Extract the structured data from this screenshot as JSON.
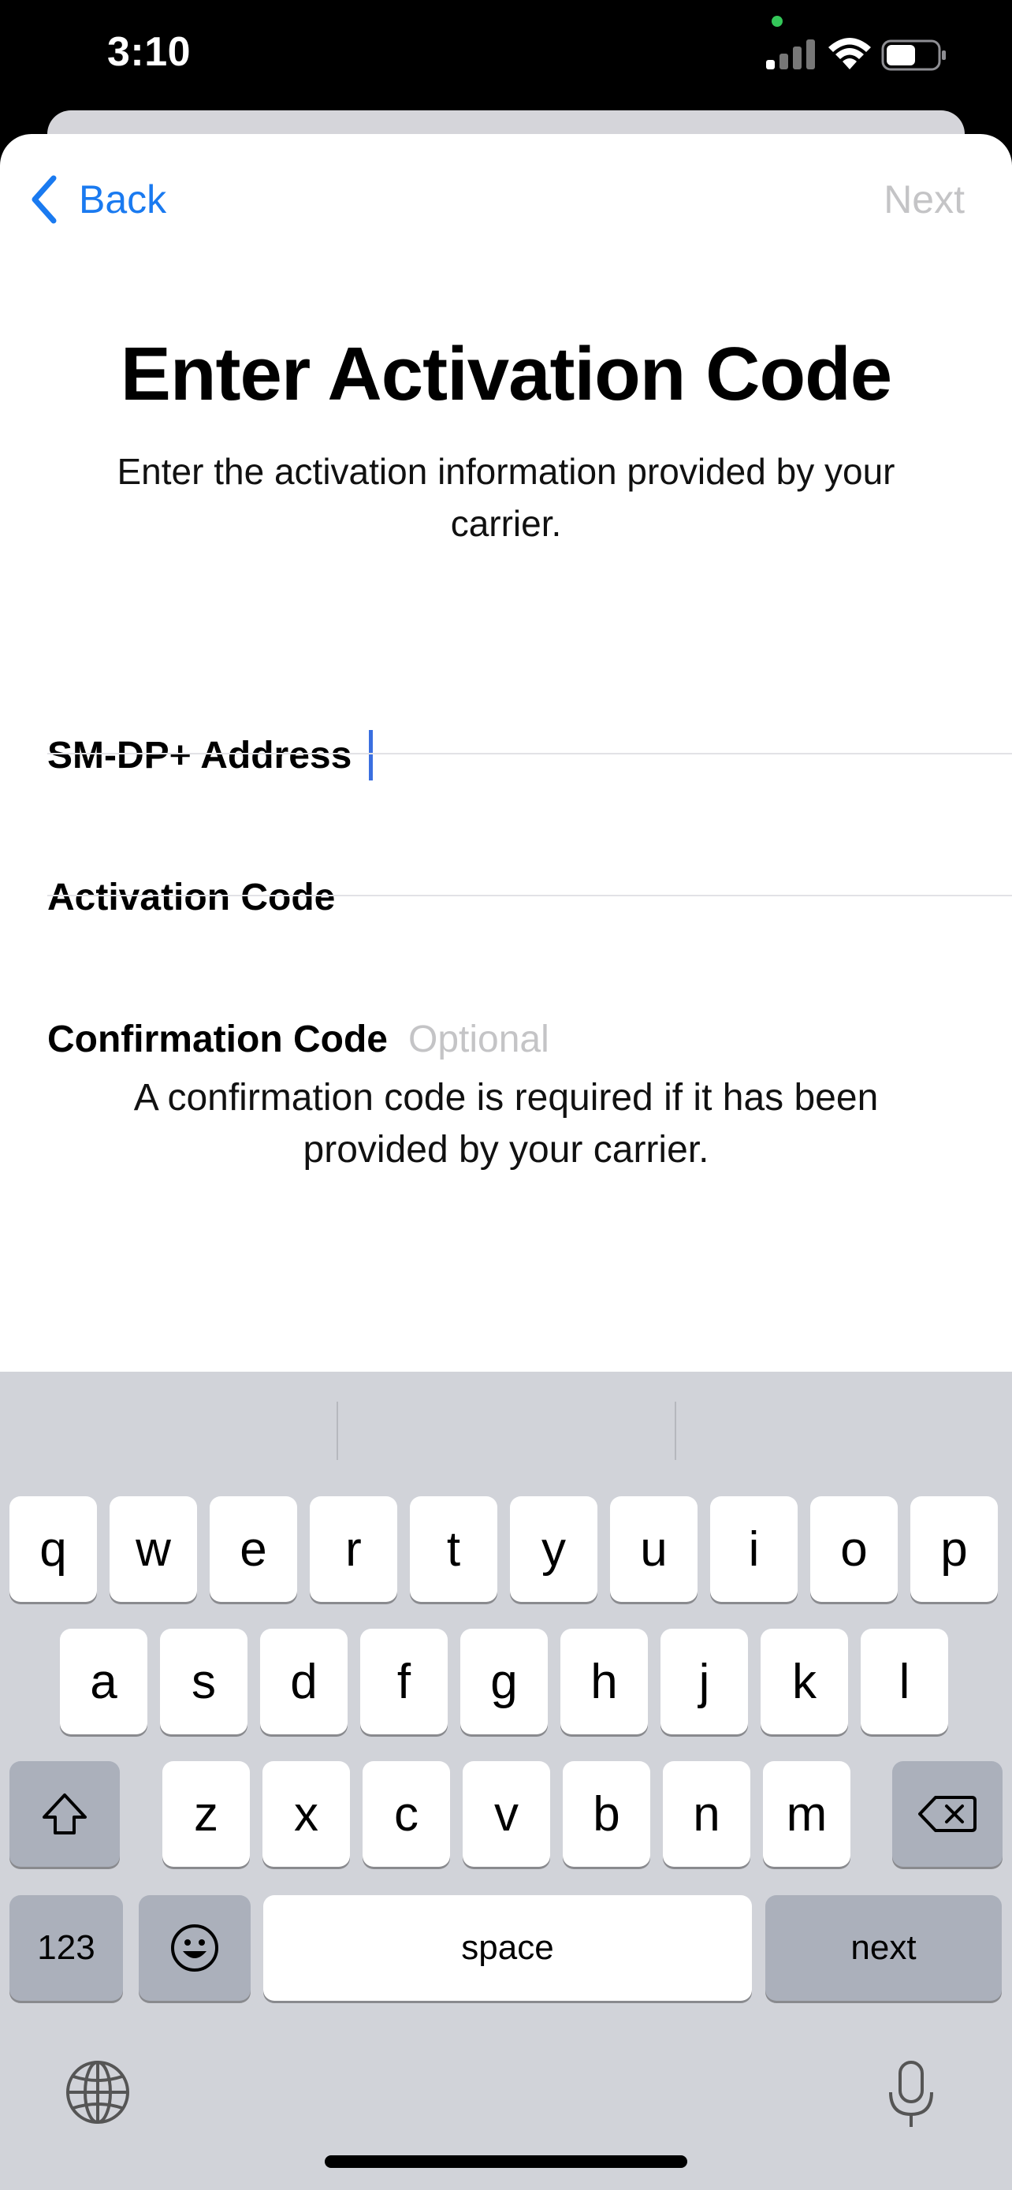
{
  "status_bar": {
    "time": "3:10",
    "signal_icon": "cellular-signal-icon",
    "wifi_icon": "wifi-icon",
    "battery_icon": "battery-icon"
  },
  "nav": {
    "back_label": "Back",
    "next_label": "Next",
    "back_icon": "chevron-left-icon"
  },
  "title": "Enter Activation Code",
  "subtitle": "Enter the activation information provided by your carrier.",
  "fields": [
    {
      "label": "SM-DP+ Address",
      "value": "",
      "placeholder": ""
    },
    {
      "label": "Activation Code",
      "value": "",
      "placeholder": ""
    },
    {
      "label": "Confirmation Code",
      "value": "",
      "placeholder": "Optional"
    }
  ],
  "note": "A confirmation code is required if it has been provided by your carrier.",
  "keyboard": {
    "row1": [
      "q",
      "w",
      "e",
      "r",
      "t",
      "y",
      "u",
      "i",
      "o",
      "p"
    ],
    "row2": [
      "a",
      "s",
      "d",
      "f",
      "g",
      "h",
      "j",
      "k",
      "l"
    ],
    "row3": [
      "z",
      "x",
      "c",
      "v",
      "b",
      "n",
      "m"
    ],
    "numbers_label": "123",
    "space_label": "space",
    "return_label": "next",
    "shift_icon": "shift-icon",
    "delete_icon": "delete-backspace-icon",
    "emoji_icon": "emoji-icon",
    "globe_icon": "globe-icon",
    "mic_icon": "microphone-icon"
  },
  "colors": {
    "accent": "#1a7af0",
    "disabled": "#c4c4c6",
    "cursor": "#3a6fe0",
    "keyboard_bg": "#d1d3d9"
  }
}
